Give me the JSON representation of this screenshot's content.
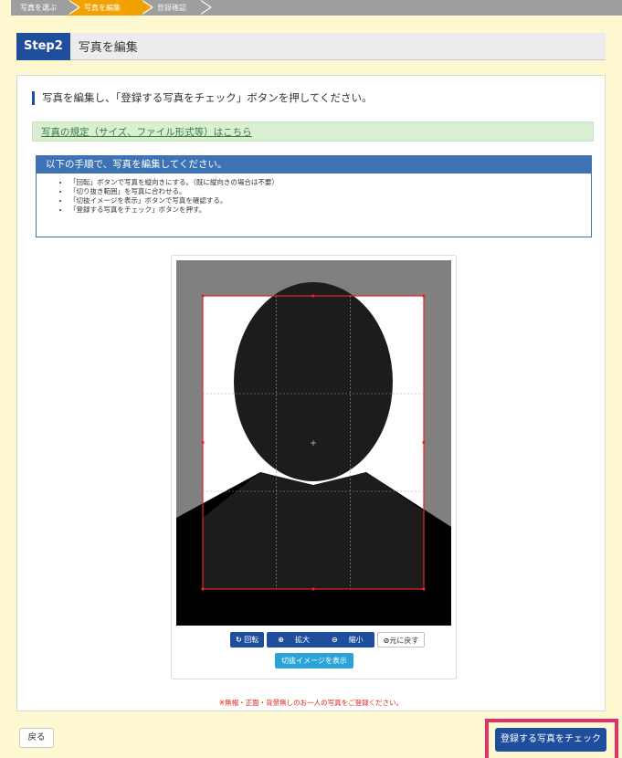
{
  "breadcrumb": {
    "steps": [
      "写真を選ぶ",
      "写真を編集",
      "登録確認"
    ],
    "active_index": 1
  },
  "step_header": {
    "badge": "Step2",
    "title": "写真を編集"
  },
  "instruction": "写真を編集し、「登録する写真をチェック」ボタンを押してください。",
  "rules_link": "写真の規定（サイズ、ファイル形式等）はこちら",
  "steps_panel": {
    "heading": "以下の手順で、写真を編集してください。",
    "items": [
      "「回転」ボタンで写真を縦向きにする。（既に縦向きの場合は不要）",
      "「切り抜き範囲」を写真に合わせる。",
      "「切抜イメージを表示」ボタンで写真を確認する。",
      "「登録する写真をチェック」ボタンを押す。"
    ]
  },
  "toolbar": {
    "rotate": "回転",
    "zoom_in": "拡大",
    "zoom_out": "縮小",
    "reset": "元に戻す",
    "preview": "切抜イメージを表示"
  },
  "warning": "※無帽・正面・背景無しのお一人の写真をご登録ください。",
  "buttons": {
    "back": "戻る",
    "submit": "登録する写真をチェック"
  },
  "colors": {
    "brand": "#1f4e9c",
    "active_step": "#f2a200",
    "crop_border": "#e0262a",
    "highlight": "#e2306c"
  }
}
